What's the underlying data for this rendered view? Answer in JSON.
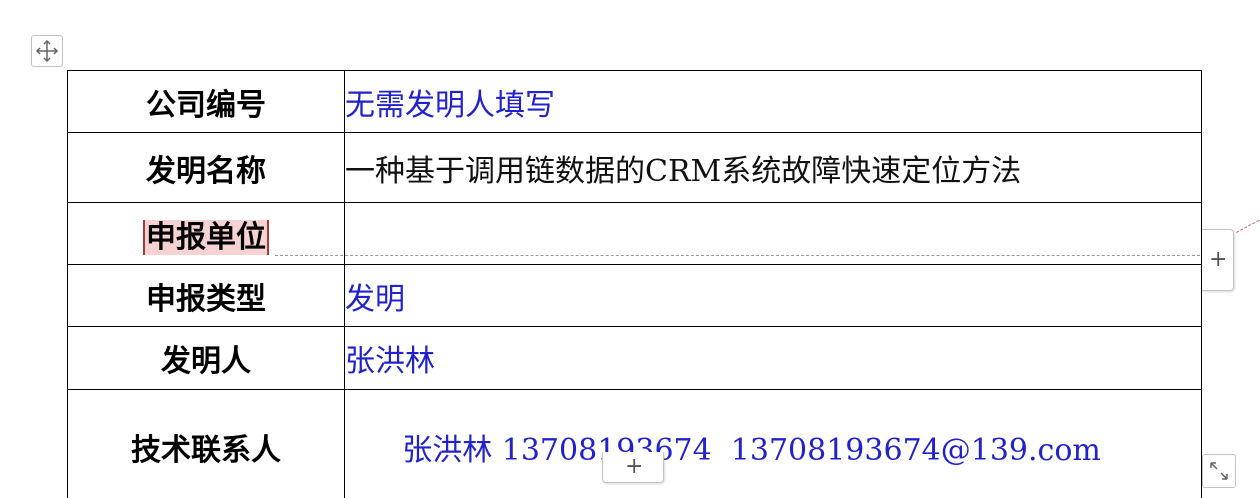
{
  "form": {
    "rows": [
      {
        "label": "公司编号",
        "value": "无需发明人填写"
      },
      {
        "label": "发明名称",
        "value": "一种基于调用链数据的CRM系统故障快速定位方法"
      },
      {
        "label": "申报单位",
        "value": ""
      },
      {
        "label": "申报类型",
        "value": "发明"
      },
      {
        "label": "发明人",
        "value": "张洪林"
      },
      {
        "label": "技术联系人",
        "value": "张洪林 13708193674  13708193674@139.com"
      }
    ]
  },
  "controls": {
    "add_row_side_icon": "+",
    "add_row_bottom_icon": "+"
  },
  "icons": {
    "move": "move-icon",
    "resize": "resize-icon"
  },
  "colors": {
    "value_text": "#2222cc",
    "label_text": "#000000",
    "highlight_bg": "#f6d2d2"
  }
}
